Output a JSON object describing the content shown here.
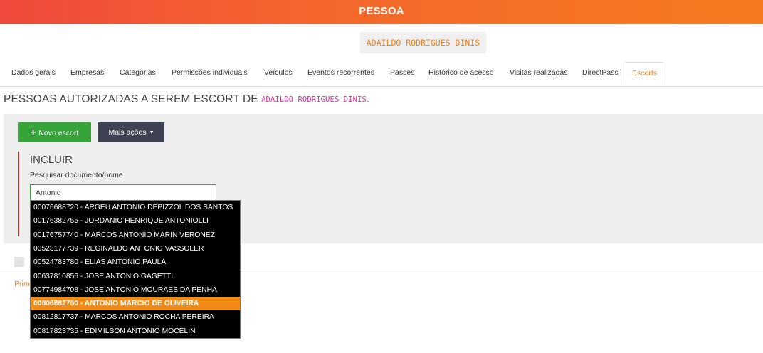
{
  "header": {
    "title": "PESSOA"
  },
  "person": {
    "name": "ADAILDO RODRIGUES DINIS"
  },
  "tabs": [
    {
      "label": "Dados gerais"
    },
    {
      "label": "Empresas"
    },
    {
      "label": "Categorias"
    },
    {
      "label": "Permissões individuais"
    },
    {
      "label": "Veículos"
    },
    {
      "label": "Eventos recorrentes"
    },
    {
      "label": "Passes"
    },
    {
      "label": "Histórico de acesso"
    },
    {
      "label": "Visitas realizadas"
    },
    {
      "label": "DirectPass"
    },
    {
      "label": "Escorts",
      "active": true
    }
  ],
  "section": {
    "title_prefix": "PESSOAS AUTORIZADAS A SEREM ESCORT DE ",
    "title_name": "ADAILDO RODRIGUES DINIS",
    "title_suffix": "."
  },
  "toolbar": {
    "new_label": "Novo escort",
    "more_label": "Mais ações"
  },
  "include": {
    "title": "INCLUIR",
    "search_label": "Pesquisar documento/nome",
    "search_value": "Antonio"
  },
  "below": {
    "link_text": "Prim"
  },
  "dropdown": {
    "selected_index": 7,
    "items": [
      "00076688720 - ARGEU ANTONIO DEPIZZOL DOS SANTOS",
      "00176382755 - JORDANIO HENRIQUE ANTONIOLLI",
      "00176757740 - MARCOS ANTONIO MARIN VERONEZ",
      "00523177739 - REGINALDO ANTONIO VASSOLER",
      "00524783780 - ELIAS ANTONIO PAULA",
      "00637810856 - JOSE ANTONIO GAGETTI",
      "00774984708 - JOSE ANTONIO MOURAES DA PENHA",
      "00806882760 - ANTONIO MARCIO DE OLIVEIRA",
      "00812817737 - MARCOS ANTONIO ROCHA PEREIRA",
      "00817823735 - EDIMILSON ANTONIO MOCELIN"
    ]
  },
  "colors": {
    "accent": "#f07f1a",
    "success": "#37a43a",
    "dark_button": "#3e4252",
    "highlight": "#d6339a"
  }
}
